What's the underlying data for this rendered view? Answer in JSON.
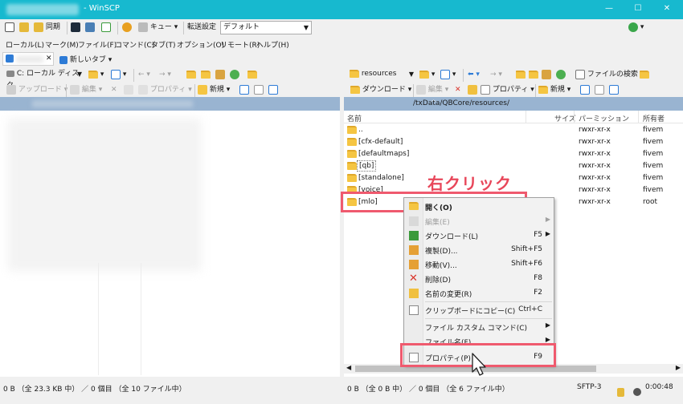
{
  "window": {
    "title": "- WinSCP",
    "minimize": "—",
    "maximize": "☐",
    "close": "✕"
  },
  "toolbar": {
    "sync_label": "同期",
    "queue_label": "キュー",
    "transfer_setting_label": "転送設定",
    "transfer_setting_value": "デフォルト"
  },
  "menubar": [
    "ローカル(L)",
    "マーク(M)",
    "ファイル(F)",
    "コマンド(C)",
    "タブ(T)",
    "オプション(O)",
    "リモート(R)",
    "ヘルプ(H)"
  ],
  "tabs": {
    "new_tab": "新しいタブ"
  },
  "local": {
    "drive": "C: ローカル ディスク",
    "upload": "アップロード",
    "edit": "編集",
    "properties": "プロパティ",
    "new": "新規",
    "status": "0 B （全 23.3 KB 中） ／ 0 個目 （全 10 ファイル中）"
  },
  "remote": {
    "folder": "resources",
    "find_files": "ファイルの検索",
    "download": "ダウンロード",
    "edit": "編集",
    "properties": "プロパティ",
    "new": "新規",
    "path": "/txData/QBCore/resources/",
    "columns": {
      "name": "名前",
      "size": "サイズ",
      "perm": "パーミッション",
      "owner": "所有者"
    },
    "rows": [
      {
        "name": "..",
        "perm": "rwxr-xr-x",
        "owner": "fivem"
      },
      {
        "name": "[cfx-default]",
        "perm": "rwxr-xr-x",
        "owner": "fivem"
      },
      {
        "name": "[defaultmaps]",
        "perm": "rwxr-xr-x",
        "owner": "fivem"
      },
      {
        "name": "[qb]",
        "perm": "rwxr-xr-x",
        "owner": "fivem"
      },
      {
        "name": "[standalone]",
        "perm": "rwxr-xr-x",
        "owner": "fivem"
      },
      {
        "name": "[voice]",
        "perm": "rwxr-xr-x",
        "owner": "fivem"
      },
      {
        "name": "[mlo]",
        "perm": "rwxr-xr-x",
        "owner": "root"
      }
    ],
    "status": "0 B （全 0 B 中） ／ 0 個目 （全 6 ファイル中）"
  },
  "status": {
    "protocol": "SFTP-3",
    "time": "0:00:48"
  },
  "context_menu": [
    {
      "label": "開く(O)",
      "shortcut": "",
      "bold": true
    },
    {
      "label": "編集(E)",
      "shortcut": "",
      "disabled": true,
      "submenu": true
    },
    {
      "label": "ダウンロード(L)",
      "shortcut": "F5",
      "submenu": true
    },
    {
      "label": "複製(D)...",
      "shortcut": "Shift+F5"
    },
    {
      "label": "移動(V)...",
      "shortcut": "Shift+F6"
    },
    {
      "label": "削除(D)",
      "shortcut": "F8"
    },
    {
      "label": "名前の変更(R)",
      "shortcut": "F2"
    },
    {
      "label": "クリップボードにコピー(C)",
      "shortcut": "Ctrl+C"
    },
    {
      "label": "ファイル カスタム コマンド(C)",
      "shortcut": "",
      "submenu": true
    },
    {
      "label": "ファイル名(F)",
      "shortcut": "",
      "submenu": true
    },
    {
      "label": "プロパティ(P)",
      "shortcut": "F9"
    }
  ],
  "annotation": {
    "label": "右クリック"
  },
  "colors": {
    "titlebar": "#17b9cf",
    "highlight": "#ef5a6e",
    "pathbar": "#99b4d1",
    "folder": "#f5c542"
  }
}
